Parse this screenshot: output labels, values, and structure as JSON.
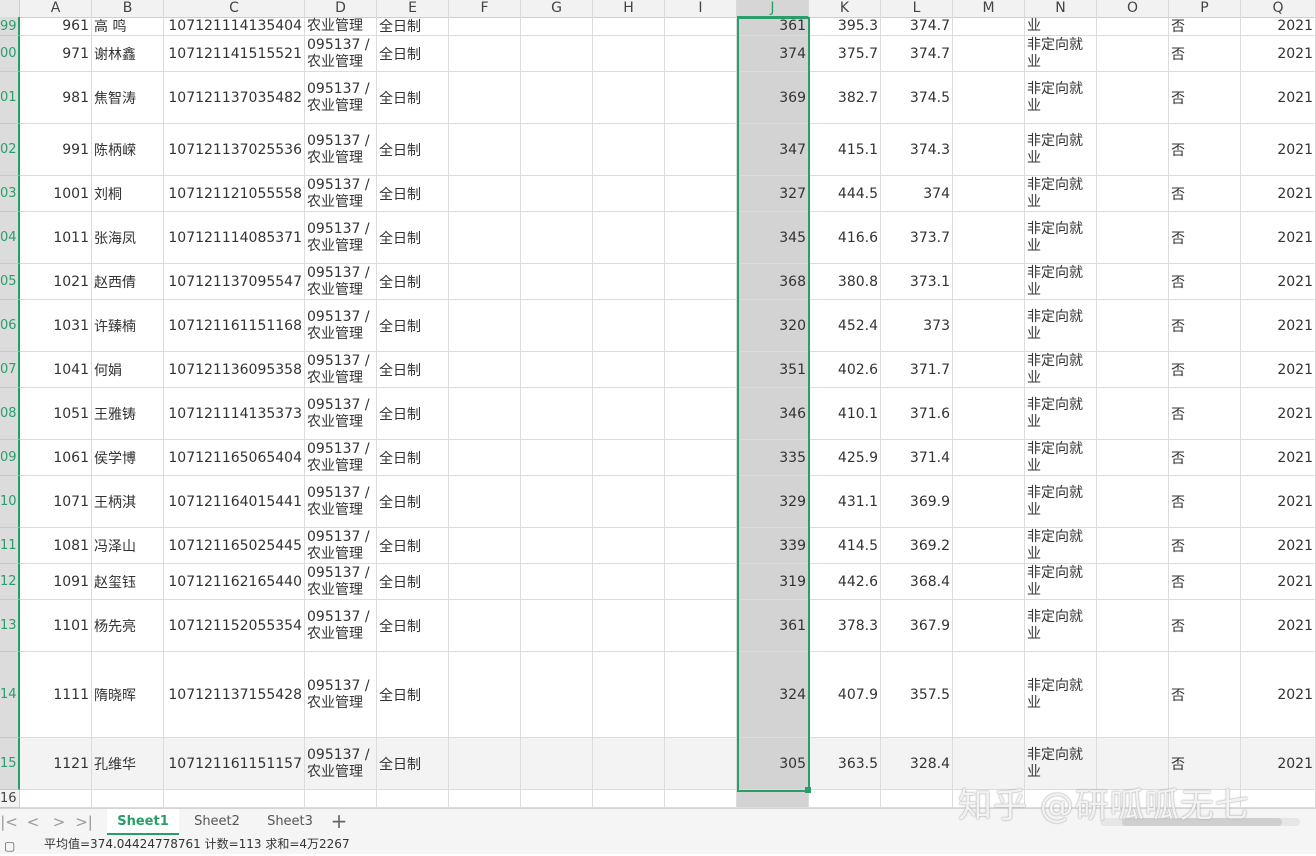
{
  "columns": [
    "A",
    "B",
    "C",
    "D",
    "E",
    "F",
    "G",
    "H",
    "I",
    "J",
    "K",
    "L",
    "M",
    "N",
    "O",
    "P",
    "Q"
  ],
  "rows": [
    {
      "rownum": "99",
      "a": "961",
      "b": "高  鸣",
      "c": "107121114135404",
      "d1": "",
      "d2": "农业管理",
      "e": "全日制",
      "j": "361",
      "k": "395.3",
      "l": "374.7",
      "n1": "",
      "n2": "业",
      "p": "否",
      "q": "2021"
    },
    {
      "rownum": "00",
      "a": "971",
      "b": "谢林鑫",
      "c": "107121141515521",
      "d1": "095137 /",
      "d2": "农业管理",
      "e": "全日制",
      "j": "374",
      "k": "375.7",
      "l": "374.7",
      "n1": "非定向就",
      "n2": "业",
      "p": "否",
      "q": "2021"
    },
    {
      "rownum": "01",
      "a": "981",
      "b": "焦智涛",
      "c": "107121137035482",
      "d1": "095137 /",
      "d2": "农业管理",
      "e": "全日制",
      "j": "369",
      "k": "382.7",
      "l": "374.5",
      "n1": "非定向就",
      "n2": "业",
      "p": "否",
      "q": "2021"
    },
    {
      "rownum": "02",
      "a": "991",
      "b": "陈柄嵘",
      "c": "107121137025536",
      "d1": "095137 /",
      "d2": "农业管理",
      "e": "全日制",
      "j": "347",
      "k": "415.1",
      "l": "374.3",
      "n1": "非定向就",
      "n2": "业",
      "p": "否",
      "q": "2021"
    },
    {
      "rownum": "03",
      "a": "1001",
      "b": "刘桐",
      "c": "107121121055558",
      "d1": "095137 /",
      "d2": "农业管理",
      "e": "全日制",
      "j": "327",
      "k": "444.5",
      "l": "374",
      "n1": "非定向就",
      "n2": "业",
      "p": "否",
      "q": "2021"
    },
    {
      "rownum": "04",
      "a": "1011",
      "b": "张海凤",
      "c": "107121114085371",
      "d1": "095137 /",
      "d2": "农业管理",
      "e": "全日制",
      "j": "345",
      "k": "416.6",
      "l": "373.7",
      "n1": "非定向就",
      "n2": "业",
      "p": "否",
      "q": "2021"
    },
    {
      "rownum": "05",
      "a": "1021",
      "b": "赵西倩",
      "c": "107121137095547",
      "d1": "095137 /",
      "d2": "农业管理",
      "e": "全日制",
      "j": "368",
      "k": "380.8",
      "l": "373.1",
      "n1": "非定向就",
      "n2": "业",
      "p": "否",
      "q": "2021"
    },
    {
      "rownum": "06",
      "a": "1031",
      "b": "许臻楠",
      "c": "107121161151168",
      "d1": "095137 /",
      "d2": "农业管理",
      "e": "全日制",
      "j": "320",
      "k": "452.4",
      "l": "373",
      "n1": "非定向就",
      "n2": "业",
      "p": "否",
      "q": "2021"
    },
    {
      "rownum": "07",
      "a": "1041",
      "b": "何娟",
      "c": "107121136095358",
      "d1": "095137 /",
      "d2": "农业管理",
      "e": "全日制",
      "j": "351",
      "k": "402.6",
      "l": "371.7",
      "n1": "非定向就",
      "n2": "业",
      "p": "否",
      "q": "2021"
    },
    {
      "rownum": "08",
      "a": "1051",
      "b": "王雅铸",
      "c": "107121114135373",
      "d1": "095137 /",
      "d2": "农业管理",
      "e": "全日制",
      "j": "346",
      "k": "410.1",
      "l": "371.6",
      "n1": "非定向就",
      "n2": "业",
      "p": "否",
      "q": "2021"
    },
    {
      "rownum": "09",
      "a": "1061",
      "b": "侯学博",
      "c": "107121165065404",
      "d1": "095137 /",
      "d2": "农业管理",
      "e": "全日制",
      "j": "335",
      "k": "425.9",
      "l": "371.4",
      "n1": "非定向就",
      "n2": "业",
      "p": "否",
      "q": "2021"
    },
    {
      "rownum": "10",
      "a": "1071",
      "b": "王柄淇",
      "c": "107121164015441",
      "d1": "095137 /",
      "d2": "农业管理",
      "e": "全日制",
      "j": "329",
      "k": "431.1",
      "l": "369.9",
      "n1": "非定向就",
      "n2": "业",
      "p": "否",
      "q": "2021"
    },
    {
      "rownum": "11",
      "a": "1081",
      "b": "冯泽山",
      "c": "107121165025445",
      "d1": "095137 /",
      "d2": "农业管理",
      "e": "全日制",
      "j": "339",
      "k": "414.5",
      "l": "369.2",
      "n1": "非定向就",
      "n2": "业",
      "p": "否",
      "q": "2021"
    },
    {
      "rownum": "12",
      "a": "1091",
      "b": "赵玺钰",
      "c": "107121162165440",
      "d1": "095137 /",
      "d2": "农业管理",
      "e": "全日制",
      "j": "319",
      "k": "442.6",
      "l": "368.4",
      "n1": "非定向就",
      "n2": "业",
      "p": "否",
      "q": "2021"
    },
    {
      "rownum": "13",
      "a": "1101",
      "b": "杨先亮",
      "c": "107121152055354",
      "d1": "095137 /",
      "d2": "农业管理",
      "e": "全日制",
      "j": "361",
      "k": "378.3",
      "l": "367.9",
      "n1": "非定向就",
      "n2": "业",
      "p": "否",
      "q": "2021"
    },
    {
      "rownum": "14",
      "a": "1111",
      "b": "隋晓晖",
      "c": "107121137155428",
      "d1": "095137 /",
      "d2": "农业管理",
      "e": "全日制",
      "j": "324",
      "k": "407.9",
      "l": "357.5",
      "n1": "非定向就",
      "n2": "业",
      "p": "否",
      "q": "2021"
    },
    {
      "rownum": "15",
      "a": "1121",
      "b": "孔维华",
      "c": "107121161151157",
      "d1": "095137 /",
      "d2": "农业管理",
      "e": "全日制",
      "j": "305",
      "k": "363.5",
      "l": "328.4",
      "n1": "非定向就",
      "n2": "业",
      "p": "否",
      "q": "2021"
    },
    {
      "rownum": "16",
      "a": "",
      "b": "",
      "c": "",
      "d1": "",
      "d2": "",
      "e": "",
      "j": "",
      "k": "",
      "l": "",
      "n1": "",
      "n2": "",
      "p": "",
      "q": ""
    }
  ],
  "sheets": [
    "Sheet1",
    "Sheet2",
    "Sheet3"
  ],
  "active_sheet": "Sheet1",
  "add_sheet_label": "+",
  "nav_glyphs": [
    "|<",
    "<",
    ">",
    ">|"
  ],
  "status": {
    "text": "平均值=374.04424778761  计数=113  求和=4万2267"
  },
  "watermark": "知乎 @研呱呱无七",
  "colors": {
    "accent": "#2a9d6a",
    "selected_column": "#d3d3d3"
  }
}
